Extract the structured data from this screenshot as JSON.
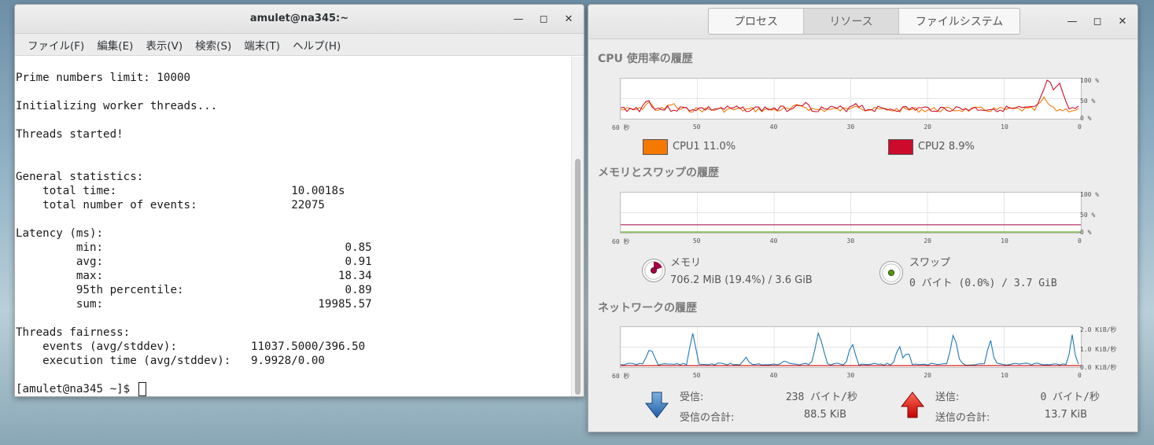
{
  "terminal": {
    "title": "amulet@na345:~",
    "menu": [
      "ファイル(F)",
      "編集(E)",
      "表示(V)",
      "検索(S)",
      "端末(T)",
      "ヘルプ(H)"
    ],
    "lines": [
      "Prime numbers limit: 10000",
      "",
      "Initializing worker threads...",
      "",
      "Threads started!",
      "",
      "",
      "General statistics:",
      "    total time:                          10.0018s",
      "    total number of events:              22075",
      "",
      "Latency (ms):",
      "         min:                                    0.85",
      "         avg:                                    0.91",
      "         max:                                   18.34",
      "         95th percentile:                        0.89",
      "         sum:                                19985.57",
      "",
      "Threads fairness:",
      "    events (avg/stddev):           11037.5000/396.50",
      "    execution time (avg/stddev):   9.9928/0.00",
      ""
    ],
    "prompt": "[amulet@na345 ~]$ "
  },
  "monitor": {
    "tabs": [
      {
        "label": "プロセス",
        "active": false
      },
      {
        "label": "リソース",
        "active": true
      },
      {
        "label": "ファイルシステム",
        "active": false
      }
    ],
    "x_ticks": [
      "60 秒",
      "50",
      "40",
      "30",
      "20",
      "10",
      "0"
    ],
    "cpu": {
      "title": "CPU 使用率の履歴",
      "y_ticks": [
        "100 %",
        "50 %",
        "0 %"
      ],
      "legend": [
        {
          "label": "CPU1 11.0%",
          "color": "#f57900"
        },
        {
          "label": "CPU2 8.9%",
          "color": "#cc0a2c"
        }
      ]
    },
    "memory": {
      "title": "メモリとスワップの履歴",
      "y_ticks": [
        "100 %",
        "50 %",
        "0 %"
      ],
      "mem_label": "メモリ",
      "mem_value": "706.2 MiB (19.4%) / 3.6 GiB",
      "mem_color": "#a40043",
      "mem_fraction": 0.194,
      "swap_label": "スワップ",
      "swap_value": "0 バイト (0.0%) / 3.7 GiB",
      "swap_color": "#4e9a06",
      "swap_fraction": 0.0
    },
    "network": {
      "title": "ネットワークの履歴",
      "y_ticks": [
        "2.0 KiB/秒",
        "1.0 KiB/秒",
        "0.0 KiB/秒"
      ],
      "recv_label": "受信:",
      "recv_value": "238 バイト/秒",
      "recv_total_label": "受信の合計:",
      "recv_total_value": "88.5 KiB",
      "send_label": "送信:",
      "send_value": "0 バイト/秒",
      "send_total_label": "送信の合計:",
      "send_total_value": "13.7 KiB",
      "recv_color": "#1f77b4",
      "send_color": "#cc0000"
    }
  }
}
